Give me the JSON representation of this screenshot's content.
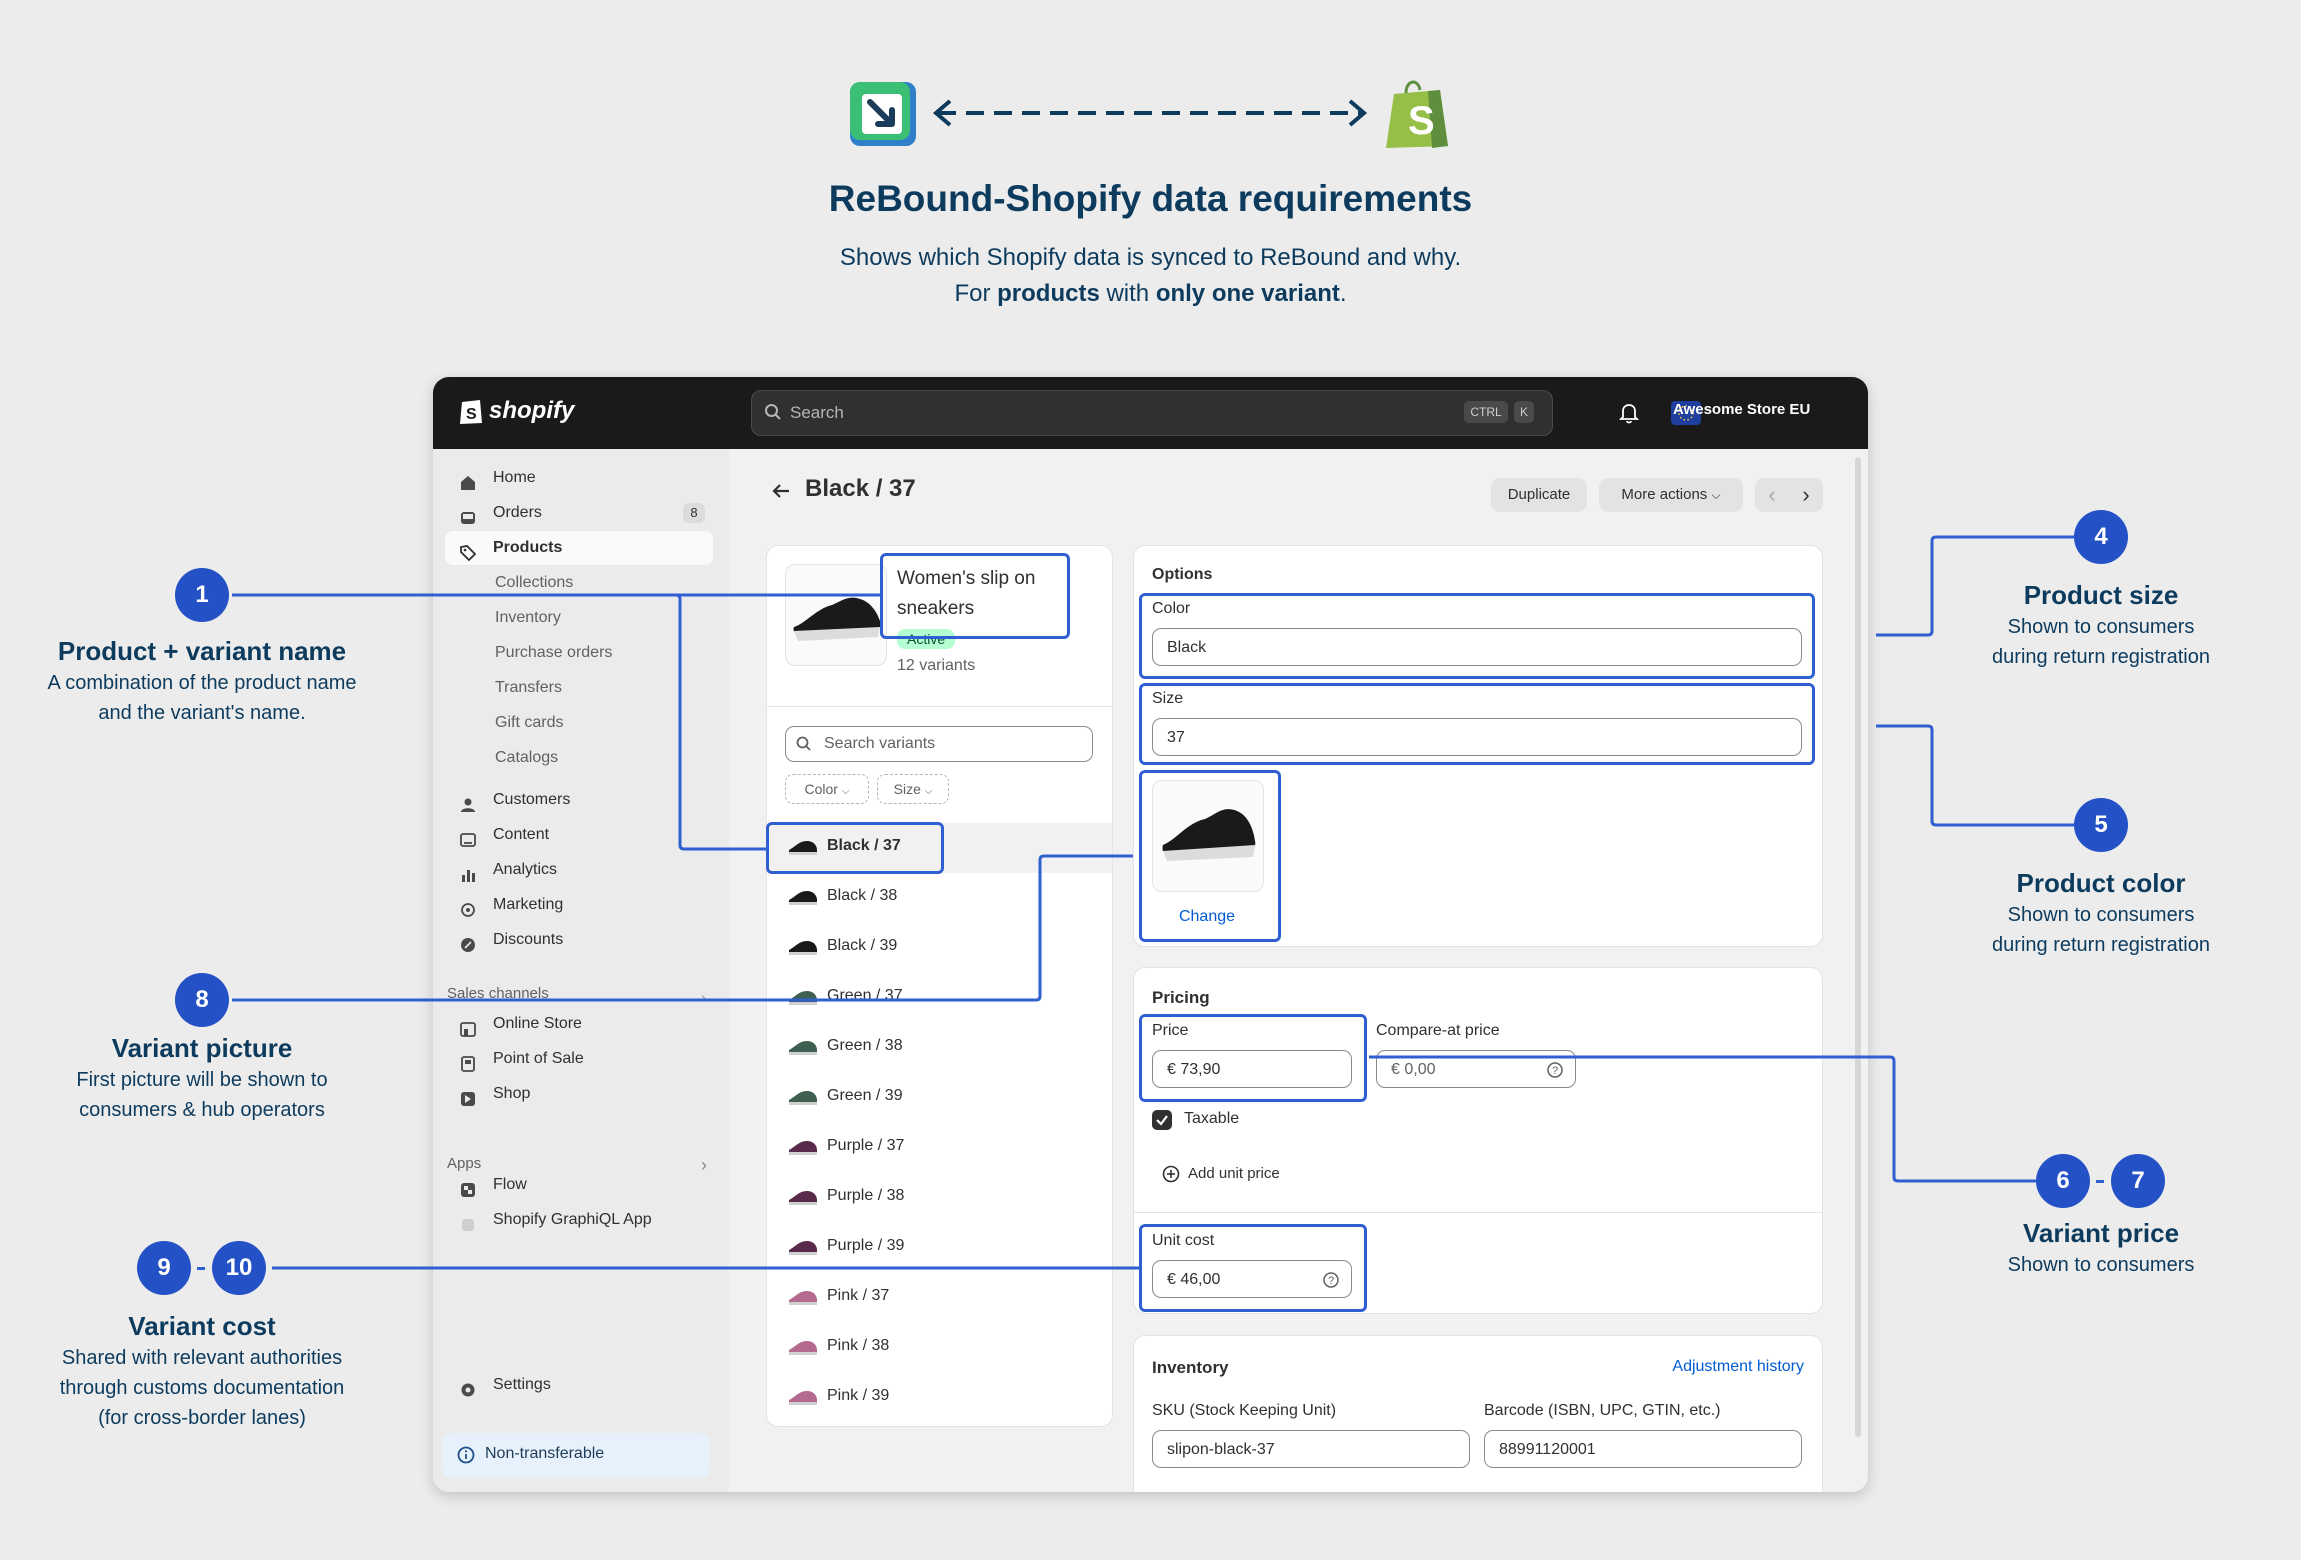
{
  "header": {
    "title": "ReBound-Shopify data requirements",
    "subtitle_line1": "Shows which Shopify data is synced to ReBound and why.",
    "subtitle_line2_pre": "For ",
    "subtitle_line2_b1": "products",
    "subtitle_line2_mid": " with ",
    "subtitle_line2_b2": "only one variant",
    "subtitle_line2_post": "."
  },
  "topbar": {
    "brand": "shopify",
    "search_placeholder": "Search",
    "kbd1": "CTRL",
    "kbd2": "K",
    "store_name": "Awesome Store EU"
  },
  "sidebar": {
    "home": "Home",
    "orders": "Orders",
    "orders_count": "8",
    "products": "Products",
    "collections": "Collections",
    "inventory": "Inventory",
    "purchase_orders": "Purchase orders",
    "transfers": "Transfers",
    "gift_cards": "Gift cards",
    "catalogs": "Catalogs",
    "customers": "Customers",
    "content": "Content",
    "analytics": "Analytics",
    "marketing": "Marketing",
    "discounts": "Discounts",
    "sales_channels": "Sales channels",
    "online_store": "Online Store",
    "point_of_sale": "Point of Sale",
    "shop": "Shop",
    "apps": "Apps",
    "flow": "Flow",
    "graphiql": "Shopify GraphiQL App",
    "settings": "Settings",
    "non_transferable": "Non-transferable"
  },
  "page": {
    "title": "Black / 37",
    "duplicate": "Duplicate",
    "more_actions": "More actions"
  },
  "product_card": {
    "name": "Women's slip on sneakers",
    "status": "Active",
    "variants_count": "12 variants",
    "search_placeholder": "Search variants",
    "filter_color": "Color",
    "filter_size": "Size",
    "variants": [
      "Black / 37",
      "Black / 38",
      "Black / 39",
      "Green / 37",
      "Green / 38",
      "Green / 39",
      "Purple / 37",
      "Purple / 38",
      "Purple / 39",
      "Pink / 37",
      "Pink / 38",
      "Pink / 39"
    ]
  },
  "options": {
    "title": "Options",
    "color_label": "Color",
    "color_value": "Black",
    "size_label": "Size",
    "size_value": "37",
    "change": "Change"
  },
  "pricing": {
    "title": "Pricing",
    "price_label": "Price",
    "price_value": "€  73,90",
    "compare_label": "Compare-at price",
    "compare_value": "€  0,00",
    "taxable": "Taxable",
    "add_unit_price": "Add unit price",
    "unit_cost_label": "Unit cost",
    "unit_cost_value": "€  46,00"
  },
  "inventory": {
    "title": "Inventory",
    "adjustment_history": "Adjustment history",
    "sku_label": "SKU (Stock Keeping Unit)",
    "sku_value": "slipon-black-37",
    "barcode_label": "Barcode (ISBN, UPC, GTIN, etc.)",
    "barcode_value": "88991120001"
  },
  "annotations": {
    "a1": {
      "num": "1",
      "title": "Product + variant name",
      "d1": "A combination of the product name",
      "d2": "and the variant's name."
    },
    "a4": {
      "num": "4",
      "title": "Product size",
      "d1": "Shown to consumers",
      "d2": "during return registration"
    },
    "a5": {
      "num": "5",
      "title": "Product color",
      "d1": "Shown to consumers",
      "d2": "during return registration"
    },
    "a67": {
      "num1": "6",
      "num2": "7",
      "title": "Variant price",
      "d1": "Shown to consumers"
    },
    "a8": {
      "num": "8",
      "title": "Variant picture",
      "d1": "First picture will be shown to",
      "d2": "consumers & hub operators"
    },
    "a910": {
      "num1": "9",
      "num2": "10",
      "title": "Variant cost",
      "d1": "Shared with relevant authorities",
      "d2": "through customs documentation",
      "d3": "(for cross-border lanes)"
    }
  },
  "colors": {
    "accent": "#2f5fd0",
    "navy": "#0d3b5e",
    "shopify_green": "#95bf47"
  }
}
